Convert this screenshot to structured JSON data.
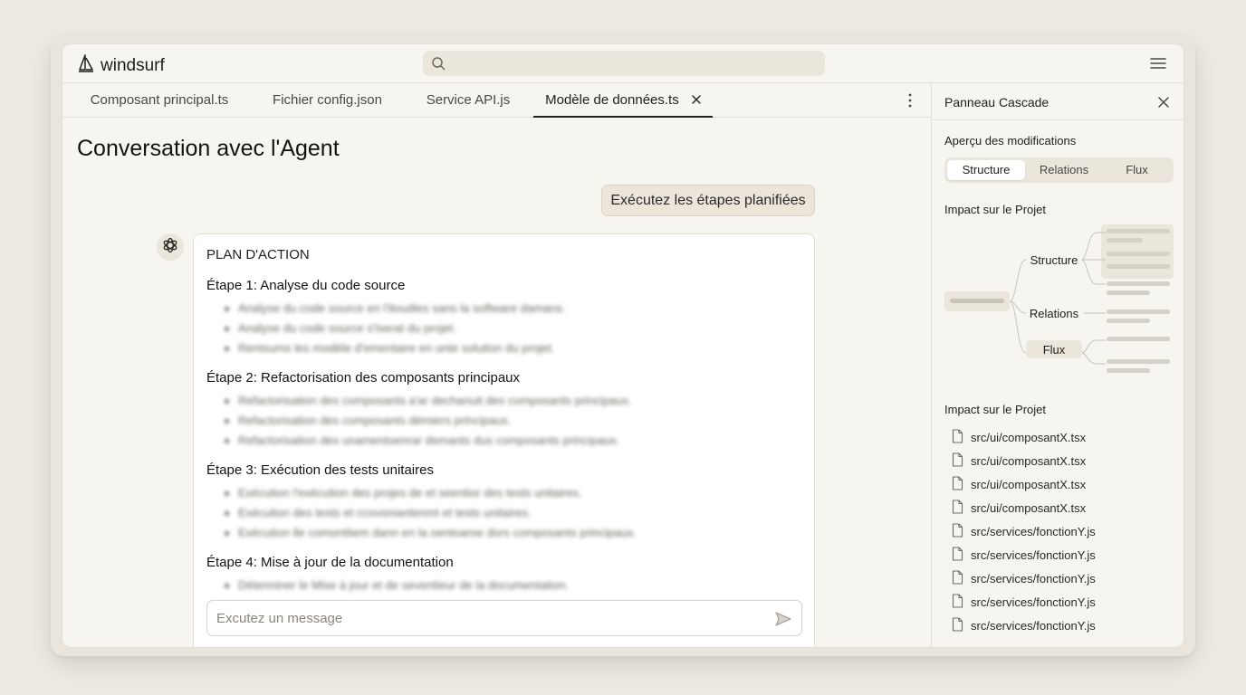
{
  "app": {
    "name": "windsurf"
  },
  "search": {
    "placeholder": ""
  },
  "tabs": [
    {
      "label": "Composant principal.ts"
    },
    {
      "label": "Fichier config.json"
    },
    {
      "label": "Service API.js"
    },
    {
      "label": "Modèle de données.ts",
      "active": true
    }
  ],
  "main": {
    "title": "Conversation avec l'Agent",
    "user_message": "Exécutez les étapes planifiées",
    "plan_heading": "PLAN D'ACTION",
    "steps": [
      {
        "title": "Étape 1: Analyse du code source",
        "items": [
          "Analyse du code source en l'itoudies sans la software damans.",
          "Analyse du code source s'iserat du projet.",
          "Rentsums les modèle d'ementaire en unte solution du projet."
        ]
      },
      {
        "title": "Étape 2: Refactorisation des composants principaux",
        "items": [
          "Refactorisation des composants a'ar dechanuit des composants principaux.",
          "Refactorisation des composants démiers principaux.",
          "Refactorisation des unamentoenrar demants dus composants principaux."
        ]
      },
      {
        "title": "Étape 3: Exécution des tests unitaires",
        "items": [
          "Exécution l'exécution des projes de et seentior des tests unitaires.",
          "Exécution des tests et ccovoniantenmt et tests unitaires.",
          "Exécution lle comonttiem dann en la oentoaroe dors composants principaux."
        ]
      },
      {
        "title": "Étape 4: Mise à jour de la documentation",
        "items": [
          "Détenniner le Mise à jour et de seventieur de la documentation."
        ]
      }
    ],
    "composer_placeholder": "Excutez un message"
  },
  "panel": {
    "title": "Panneau Cascade",
    "preview_label": "Aperçu des modifications",
    "segments": [
      {
        "label": "Structure",
        "active": true
      },
      {
        "label": "Relations"
      },
      {
        "label": "Flux"
      }
    ],
    "impact_label": "Impact sur le Projet",
    "diagram_nodes": [
      "Structure",
      "Relations",
      "Flux"
    ],
    "files_label": "Impact sur le Projet",
    "files": [
      "src/ui/composantX.tsx",
      "src/ui/composantX.tsx",
      "src/ui/composantX.tsx",
      "src/ui/composantX.tsx",
      "src/services/fonctionY.js",
      "src/services/fonctionY.js",
      "src/services/fonctionY.js",
      "src/services/fonctionY.js",
      "src/services/fonctionY.js"
    ]
  },
  "colors": {
    "background": "#efebe3",
    "surface": "#f7f5f0",
    "card": "#ffffff",
    "accent_beige": "#ece6da",
    "text": "#1f1e1c"
  }
}
